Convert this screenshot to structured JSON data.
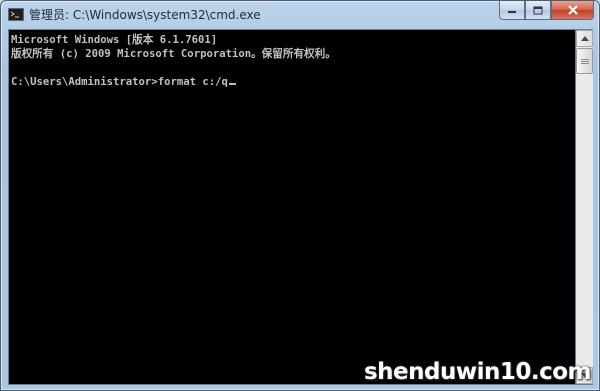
{
  "window": {
    "title": "管理员: C:\\Windows\\system32\\cmd.exe",
    "icon": "cmd-icon",
    "caption_buttons": [
      "minimize-icon",
      "maximize-icon",
      "close-icon"
    ]
  },
  "console": {
    "lines": [
      "Microsoft Windows [版本 6.1.7601]",
      "版权所有 (c) 2009 Microsoft Corporation。保留所有权利。",
      "",
      "C:\\Users\\Administrator>format c:/q"
    ],
    "text_color": "#c0c0c0",
    "background": "#000000"
  },
  "watermark": {
    "text": "shenduwin10.com"
  },
  "colors": {
    "title_bar": "#aac6e4",
    "close_button": "#c2402a"
  }
}
